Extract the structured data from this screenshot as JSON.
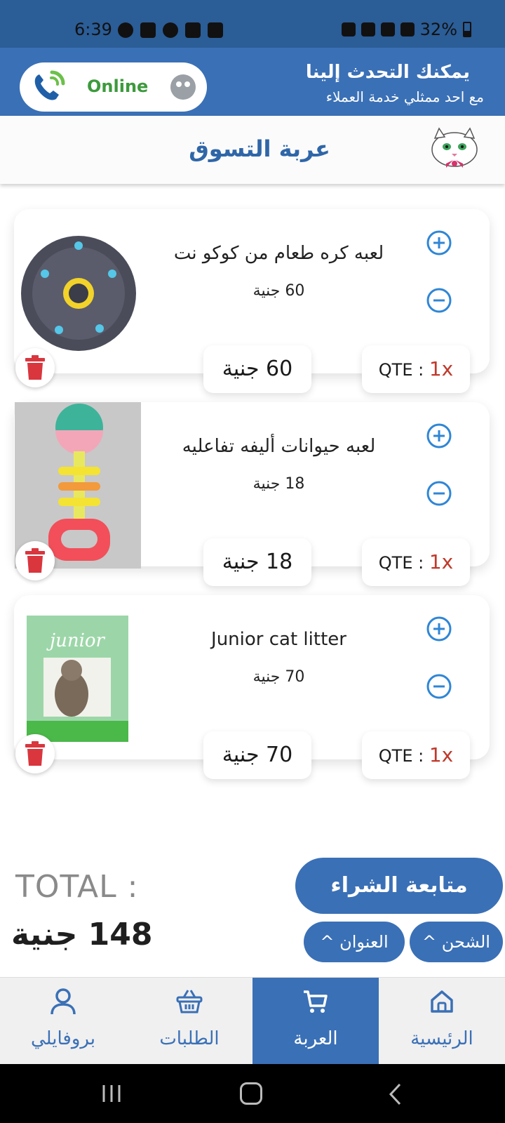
{
  "status_bar": {
    "time": "6:39",
    "battery": "32%"
  },
  "support": {
    "online_label": "Online",
    "title": "يمكنك التحدث إلينا",
    "subtitle": "مع احد ممثلي خدمة العملاء"
  },
  "header": {
    "title": "عربة التسوق"
  },
  "cart": {
    "items": [
      {
        "name": "لعبه كره طعام من كوكو نت",
        "price": "60 جنية",
        "total": "60 جنية",
        "qty_label": "QTE : ",
        "qty_value": "1x"
      },
      {
        "name": "لعبه حيوانات أليفه تفاعليه",
        "price": "18 جنية",
        "total": "18 جنية",
        "qty_label": "QTE : ",
        "qty_value": "1x"
      },
      {
        "name": "Junior cat litter",
        "price": "70 جنية",
        "total": "70 جنية",
        "qty_label": "QTE : ",
        "qty_value": "1x"
      }
    ]
  },
  "summary": {
    "total_label": "TOTAL :",
    "total_value": "148 جنية",
    "checkout_label": "متابعة الشراء",
    "shipping_label": "الشحن ^",
    "address_label": "العنوان ^"
  },
  "bottom_nav": {
    "items": [
      {
        "label": "الرئيسية",
        "icon": "home-icon"
      },
      {
        "label": "العربة",
        "icon": "cart-icon",
        "active": true
      },
      {
        "label": "الطلبات",
        "icon": "basket-icon"
      },
      {
        "label": "بروفايلي",
        "icon": "profile-icon"
      }
    ]
  },
  "colors": {
    "primary": "#3a70b6",
    "status_bar": "#2b5d97",
    "online": "#3c9a3c",
    "delete": "#d9363e",
    "qty": "#c0392b"
  }
}
